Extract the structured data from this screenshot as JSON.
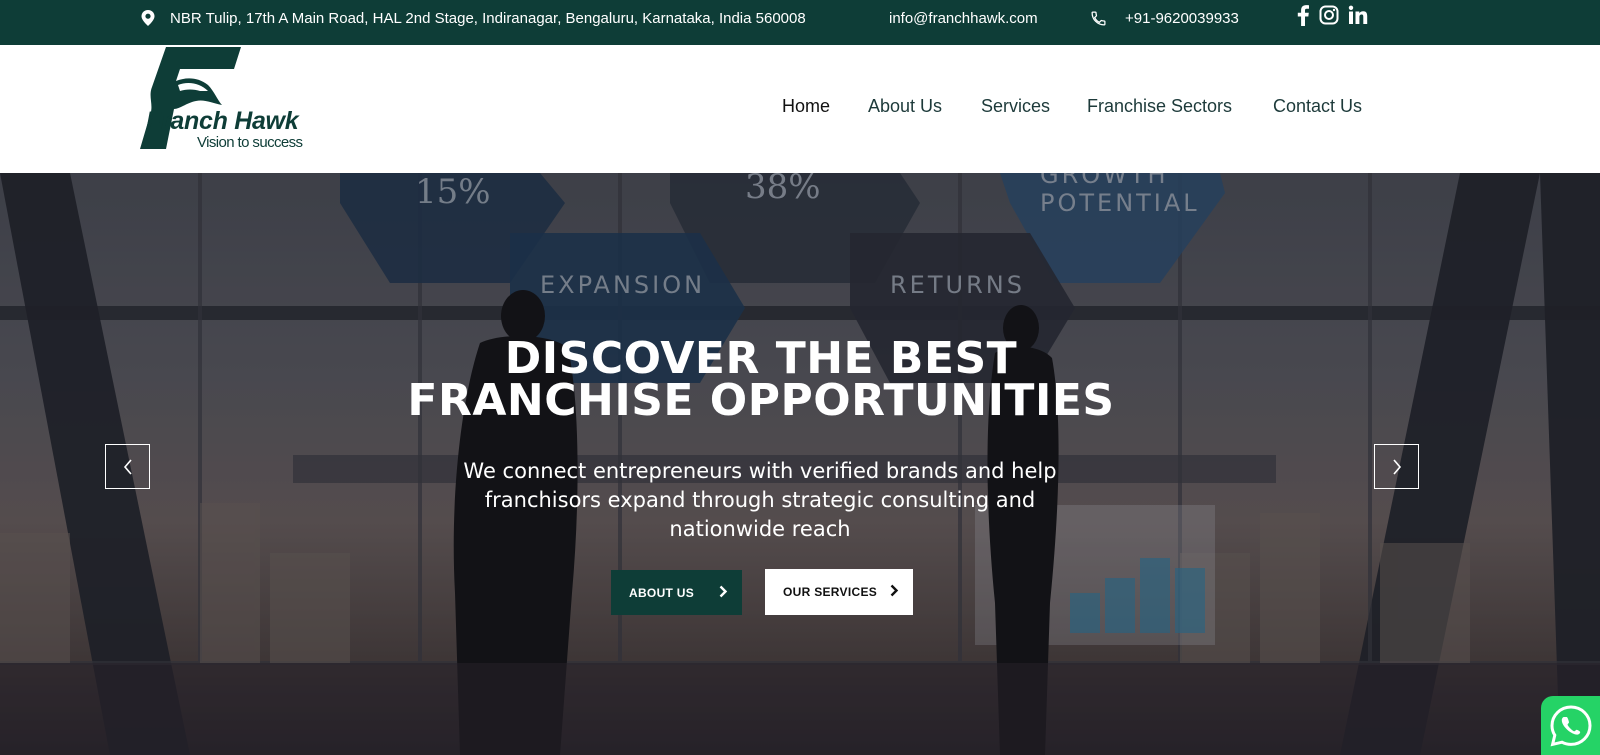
{
  "topbar": {
    "address": "NBR Tulip, 17th A Main Road, HAL 2nd Stage, Indiranagar, Bengaluru, Karnataka, India 560008",
    "email": "info@franchhawk.com",
    "phone": "+91-9620039933",
    "social": [
      "facebook-icon",
      "instagram-icon",
      "linkedin-icon"
    ]
  },
  "brand": {
    "name": "Franch Hawk",
    "tagline": "Vision to success"
  },
  "nav": {
    "items": [
      "Home",
      "About Us",
      "Services",
      "Franchise Sectors",
      "Contact Us"
    ],
    "active": "Home"
  },
  "hero": {
    "title_line1": "DISCOVER  THE BEST",
    "title_line2": "FRANCHISE OPPORTUNITIES",
    "subtitle": "We connect entrepreneurs with verified brands and help franchisors expand through strategic consulting and nationwide reach",
    "primary_button": "ABOUT US",
    "secondary_button": "OUR SERVICES",
    "background_labels": [
      "15%",
      "38%",
      "GROWTH",
      "POTENTIAL",
      "EXPANSION",
      "RETURNS"
    ]
  },
  "colors": {
    "brand_dark": "#0e3d37",
    "whatsapp": "#25d366",
    "white": "#ffffff"
  }
}
